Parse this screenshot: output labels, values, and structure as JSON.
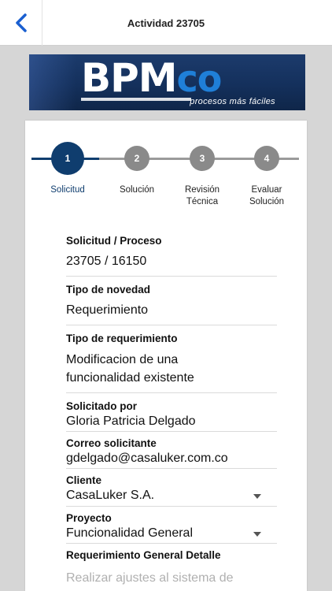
{
  "header": {
    "title": "Actividad 23705"
  },
  "banner": {
    "logo_main": "BPM",
    "logo_accent": "co",
    "tagline": "procesos más fáciles"
  },
  "stepper": {
    "steps": [
      {
        "number": "1",
        "label": "Solicitud",
        "state": "active"
      },
      {
        "number": "2",
        "label": "Solución",
        "state": "pending"
      },
      {
        "number": "3",
        "label_line1": "Revisión",
        "label_line2": "Técnica",
        "state": "pending"
      },
      {
        "number": "4",
        "label_line1": "Evaluar",
        "label_line2": "Solución",
        "state": "pending"
      }
    ]
  },
  "form": {
    "solicitud": {
      "label": "Solicitud / Proceso",
      "value": "23705 / 16150"
    },
    "tipo_novedad": {
      "label": "Tipo de novedad",
      "value": "Requerimiento"
    },
    "tipo_requerimiento": {
      "label": "Tipo de requerimiento",
      "value_line1": "Modificacion de una",
      "value_line2": "funcionalidad existente"
    },
    "solicitado_por": {
      "label": "Solicitado por",
      "value": "Gloria Patricia Delgado"
    },
    "correo": {
      "label": "Correo solicitante",
      "value": "gdelgado@casaluker.com.co"
    },
    "cliente": {
      "label": "Cliente",
      "value": "CasaLuker S.A."
    },
    "proyecto": {
      "label": "Proyecto",
      "value": "Funcionalidad General"
    },
    "detalle": {
      "label": "Requerimiento General Detalle",
      "value": "Realizar ajustes al sistema de"
    }
  },
  "colors": {
    "accent": "#1a5fd0",
    "step_active": "#0f3d6e",
    "step_pending": "#8a8a8a"
  }
}
